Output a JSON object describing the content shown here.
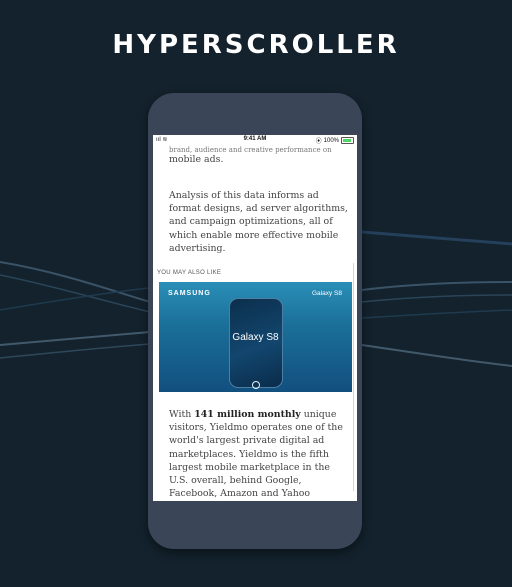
{
  "header": {
    "title": "HYPERSCROLLER"
  },
  "status_bar": {
    "signal": "ııl",
    "wifi": "≋",
    "time": "9:41 AM",
    "lock": "⦿",
    "battery_percent": "100%"
  },
  "article": {
    "truncated_line": "brand, audience and creative performance on",
    "paragraph_0": "mobile ads.",
    "paragraph_1": "Analysis of this data informs ad format designs, ad server algorithms, and campaign optimizations, all of which enable more effective mobile advertising.",
    "section_label": "YOU MAY ALSO LIKE",
    "paragraph_2_pre": "With ",
    "paragraph_2_bold": "141 million monthly",
    "paragraph_2_post": " unique visitors, Yieldmo operates one of the world's largest private digital ad marketplaces. Yieldmo is the fifth largest mobile marketplace in the U.S. overall, behind Google, Facebook, Amazon and Yahoo (verified by comScore)."
  },
  "ad": {
    "brand": "SAMSUNG",
    "product_corner": "Galaxy S8",
    "product_center": "Galaxy S8"
  },
  "colors": {
    "background": "#13222d",
    "phone_body": "#3a4657",
    "ad_blue": "#1a6f99",
    "battery_green": "#4cd964"
  }
}
